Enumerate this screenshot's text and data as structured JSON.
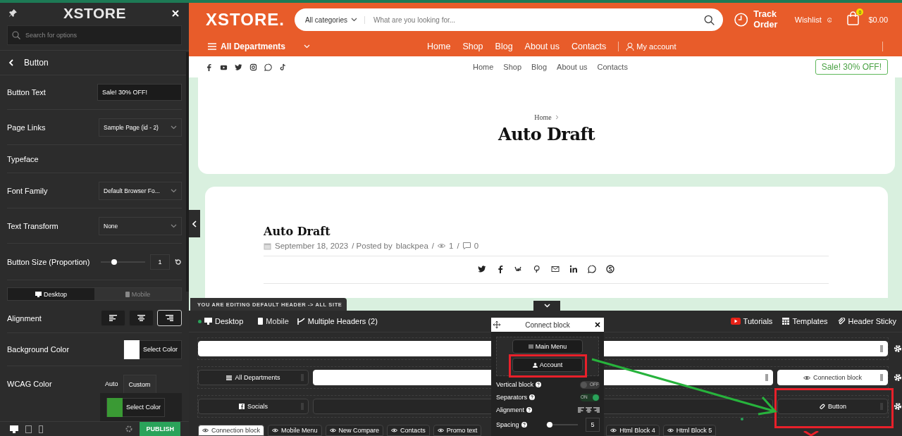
{
  "customizer": {
    "logo": "XSTORE",
    "search": {
      "placeholder": "Search for options"
    },
    "section_title": "Button",
    "settings": [
      {
        "kind": "text",
        "label": "Button Text",
        "value": "Sale! 30% OFF!"
      },
      {
        "kind": "select",
        "label": "Page Links",
        "value": "Sample Page (id - 2)"
      },
      {
        "kind": "heading",
        "label": "Typeface"
      },
      {
        "kind": "select",
        "label": "Font Family",
        "value": "Default Browser Fo..."
      },
      {
        "kind": "select",
        "label": "Text Transform",
        "value": "None"
      },
      {
        "kind": "slider",
        "label": "Button Size (Proportion)",
        "level": 0.3,
        "value": "1"
      },
      {
        "kind": "devices",
        "tabs": [
          {
            "label": "Desktop",
            "selected": true
          },
          {
            "label": "Mobile",
            "selected": false
          }
        ]
      },
      {
        "kind": "align",
        "label": "Alignment",
        "options": [
          {
            "kind": "left",
            "selected": false
          },
          {
            "kind": "center",
            "selected": false
          },
          {
            "kind": "right",
            "selected": true
          }
        ]
      },
      {
        "kind": "color",
        "label": "Background Color",
        "color": "#ffffff",
        "button": "Select Color"
      },
      {
        "kind": "wcag",
        "label": "WCAG Color",
        "tabs": [
          {
            "label": "Auto",
            "selected": false
          },
          {
            "label": "Custom",
            "selected": true
          }
        ],
        "color": "#3a9a34",
        "button": "Select Color"
      }
    ],
    "publish": "PUBLISH"
  },
  "site": {
    "logo": "XSTORE.",
    "categories": "All categories",
    "search_placeholder": "What are you looking for...",
    "track": "Track Order",
    "wishlist": "Wishlist",
    "cart_count": "0",
    "cart_total": "$0.00",
    "departments": "All Departments",
    "menu": [
      "Home",
      "Shop",
      "Blog",
      "About us",
      "Contacts"
    ],
    "account": "My account",
    "top_menu": [
      "Home",
      "Shop",
      "Blog",
      "About us",
      "Contacts"
    ],
    "sale_button": "Sale! 30% OFF!",
    "breadcrumb": "Home",
    "page_title": "Auto Draft",
    "post": {
      "title": "Auto Draft",
      "date": "September 18, 2023",
      "posted_by": "/ Posted by",
      "author": "blackpea",
      "separators": [
        "/",
        "/"
      ],
      "views": "1",
      "comments": "0"
    }
  },
  "builder": {
    "notice": "YOU ARE EDITING DEFAULT HEADER -> ALL SITE",
    "views": [
      {
        "label": "Desktop",
        "selected": true
      },
      {
        "label": "Mobile",
        "selected": false
      }
    ],
    "multiple": "Multiple Headers (2)",
    "links": [
      "Tutorials",
      "Templates",
      "Header Sticky"
    ],
    "rows": [
      {
        "blocks": [
          {
            "kind": "light"
          }
        ]
      },
      {
        "blocks": [
          {
            "kind": "dark",
            "label": "All Departments",
            "highlighted": false
          },
          {
            "kind": "light"
          },
          {
            "kind": "light",
            "label": "Connection block",
            "highlighted": false
          }
        ]
      },
      {
        "blocks": [
          {
            "kind": "dark",
            "label": "Socials",
            "highlighted": false
          },
          {
            "kind": "dark"
          },
          {
            "kind": "dark",
            "label": "Button",
            "highlighted": true
          }
        ]
      }
    ],
    "elements": [
      {
        "label": "Connection block",
        "selected": true
      },
      {
        "label": "Mobile Menu",
        "selected": false
      },
      {
        "label": "New Compare",
        "selected": false
      },
      {
        "label": "Contacts",
        "selected": false
      },
      {
        "label": "Promo text",
        "selected": false
      },
      {
        "label": "Html Block 4",
        "selected": false
      },
      {
        "label": "Html Block 5",
        "selected": false
      }
    ],
    "popup": {
      "title": "Connect block",
      "items": [
        {
          "label": "Main Menu",
          "highlighted": false
        },
        {
          "label": "Account",
          "highlighted": true
        }
      ],
      "settings": [
        {
          "kind": "toggle",
          "label": "Vertical block",
          "on": false,
          "text": "OFF"
        },
        {
          "kind": "toggle",
          "label": "Separators",
          "on": true,
          "text": "ON"
        },
        {
          "kind": "align",
          "label": "Alignment"
        },
        {
          "kind": "number",
          "label": "Spacing",
          "level": 0.1,
          "value": "5"
        }
      ]
    }
  }
}
